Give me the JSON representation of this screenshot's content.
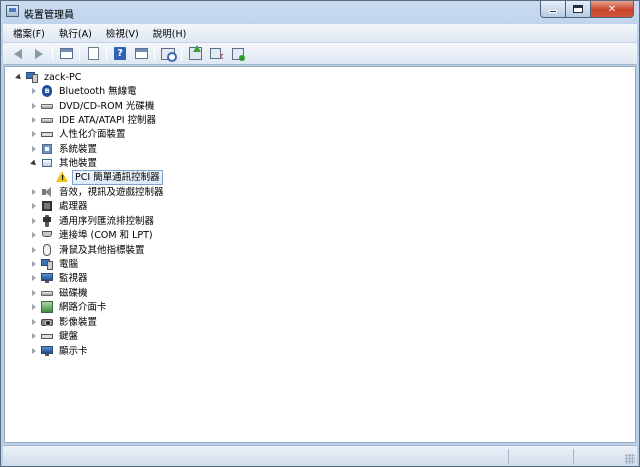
{
  "window": {
    "title": "裝置管理員"
  },
  "menu": [
    "檔案(F)",
    "執行(A)",
    "檢視(V)",
    "說明(H)"
  ],
  "toolbar": [
    "back",
    "forward",
    "window",
    "properties",
    "help",
    "window2",
    "scan",
    "update",
    "disable",
    "enable"
  ],
  "tree": {
    "root": "zack-PC",
    "items": [
      {
        "label": "Bluetooth 無線電",
        "icon": "bluetooth-icon",
        "expanded": false
      },
      {
        "label": "DVD/CD-ROM 光碟機",
        "icon": "dvd-drive-icon",
        "expanded": false
      },
      {
        "label": "IDE ATA/ATAPI 控制器",
        "icon": "ide-controller-icon",
        "expanded": false
      },
      {
        "label": "人性化介面裝置",
        "icon": "hid-icon",
        "expanded": false
      },
      {
        "label": "系統裝置",
        "icon": "system-device-icon",
        "expanded": false
      },
      {
        "label": "其他裝置",
        "icon": "other-devices-icon",
        "expanded": true,
        "children": [
          {
            "label": "PCI 簡單通訊控制器",
            "icon": "warning-icon",
            "selected": true
          }
        ]
      },
      {
        "label": "音效，視訊及遊戲控制器",
        "icon": "sound-icon",
        "expanded": false
      },
      {
        "label": "處理器",
        "icon": "processor-icon",
        "expanded": false
      },
      {
        "label": "通用序列匯流排控制器",
        "icon": "usb-icon",
        "expanded": false
      },
      {
        "label": "連接埠 (COM 和 LPT)",
        "icon": "port-icon",
        "expanded": false
      },
      {
        "label": "滑鼠及其他指標裝置",
        "icon": "mouse-icon",
        "expanded": false
      },
      {
        "label": "電腦",
        "icon": "computer-icon",
        "expanded": false
      },
      {
        "label": "監視器",
        "icon": "monitor-icon",
        "expanded": false
      },
      {
        "label": "磁碟機",
        "icon": "disk-drive-icon",
        "expanded": false
      },
      {
        "label": "網路介面卡",
        "icon": "network-adapter-icon",
        "expanded": false
      },
      {
        "label": "影像裝置",
        "icon": "imaging-device-icon",
        "expanded": false
      },
      {
        "label": "鍵盤",
        "icon": "keyboard-icon",
        "expanded": false
      },
      {
        "label": "顯示卡",
        "icon": "display-adapter-icon",
        "expanded": false
      }
    ]
  }
}
